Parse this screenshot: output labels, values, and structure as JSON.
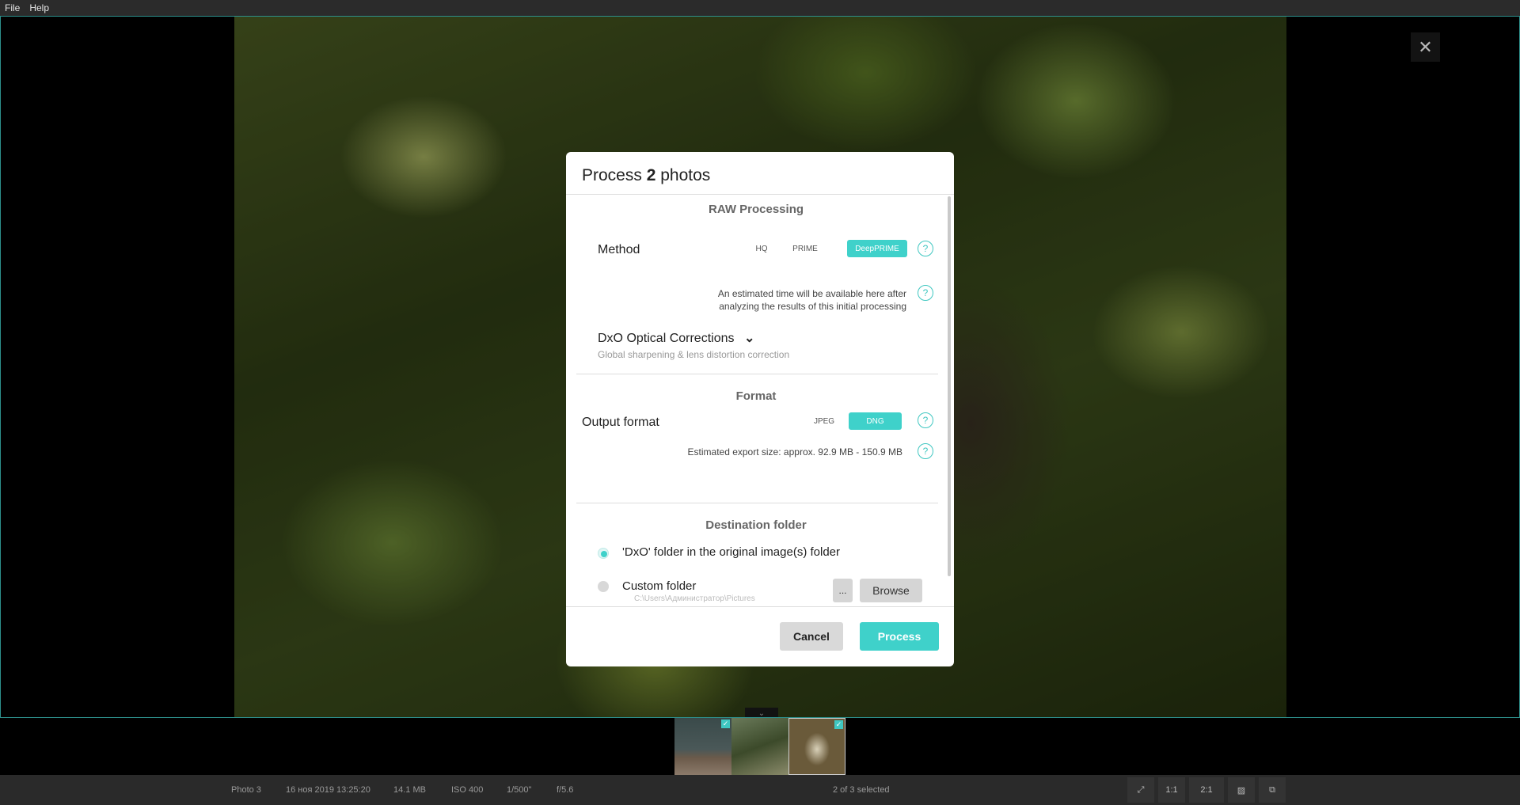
{
  "menu": {
    "file": "File",
    "help": "Help"
  },
  "viewer": {
    "close_glyph": "✕",
    "collapse_glyph": "⌄"
  },
  "filmstrip": {
    "check_glyph": "✓"
  },
  "status": {
    "photo_name": "Photo 3",
    "date": "16 ноя 2019 13:25:20",
    "size": "14.1 MB",
    "iso": "ISO 400",
    "shutter": "1/500\"",
    "aperture": "f/5.6",
    "selection": "2 of 3 selected",
    "zoom_1": "1:1",
    "zoom_2": "2:1"
  },
  "dialog": {
    "title_prefix": "Process",
    "title_count": "2",
    "title_suffix": "photos",
    "raw": {
      "heading": "RAW Processing",
      "method_label": "Method",
      "methods": [
        "HQ",
        "PRIME",
        "DeepPRIME"
      ],
      "selected_method": "DeepPRIME",
      "estimate_line1": "An estimated time will be available here after",
      "estimate_line2": "analyzing the results of this initial processing",
      "optical_label": "DxO Optical Corrections",
      "optical_sub": "Global sharpening & lens distortion correction"
    },
    "format": {
      "heading": "Format",
      "output_label": "Output format",
      "options": [
        "JPEG",
        "DNG"
      ],
      "selected": "DNG",
      "export_size_label": "Estimated export size:",
      "export_size_value": "approx. 92.9 MB - 150.9 MB"
    },
    "destination": {
      "heading": "Destination folder",
      "option_dxo": "'DxO' folder in the original image(s) folder",
      "option_custom": "Custom folder",
      "custom_path": "C:\\Users\\Администратор\\Pictures",
      "dots_label": "...",
      "browse_label": "Browse"
    },
    "help_glyph": "?",
    "cancel_label": "Cancel",
    "process_label": "Process"
  },
  "colors": {
    "accent": "#3fd1ca",
    "frame": "#3fc7c1"
  }
}
